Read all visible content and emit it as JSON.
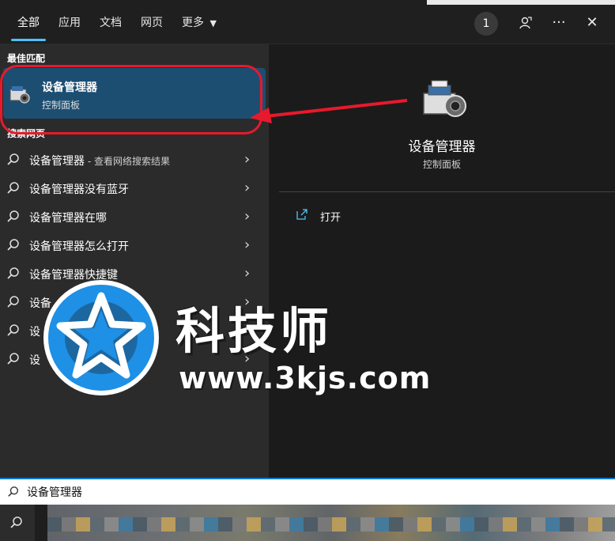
{
  "tabs": [
    {
      "label": "全部",
      "active": true
    },
    {
      "label": "应用"
    },
    {
      "label": "文档"
    },
    {
      "label": "网页"
    },
    {
      "label": "更多"
    }
  ],
  "header": {
    "badge_count": "1",
    "more_icon": "ellipsis-icon",
    "close_icon": "close-icon",
    "feedback_icon": "feedback-icon"
  },
  "best_match": {
    "section_label": "最佳匹配",
    "title": "设备管理器",
    "subtitle": "控制面板",
    "icon": "device-manager-icon"
  },
  "web_section_label": "搜索网页",
  "web_results": [
    {
      "text": "设备管理器",
      "suffix": " - 查看网络搜索结果"
    },
    {
      "text": "设备管理器没有蓝牙",
      "suffix": ""
    },
    {
      "text": "设备管理器在哪",
      "suffix": ""
    },
    {
      "text": "设备管理器怎么打开",
      "suffix": ""
    },
    {
      "text": "设备管理器快捷键",
      "suffix": ""
    },
    {
      "text": "设备",
      "suffix": ""
    },
    {
      "text": "设",
      "suffix": ""
    },
    {
      "text": "设",
      "suffix": ""
    }
  ],
  "detail": {
    "title": "设备管理器",
    "subtitle": "控制面板",
    "actions": [
      {
        "label": "打开",
        "icon": "open-icon"
      }
    ]
  },
  "search": {
    "value": "设备管理器"
  },
  "watermark": {
    "title": "科技师",
    "url": "www.3kjs.com"
  },
  "colors": {
    "accent": "#4cc2ff",
    "highlight": "#1c4e72",
    "annotation_red": "#e8192c"
  }
}
